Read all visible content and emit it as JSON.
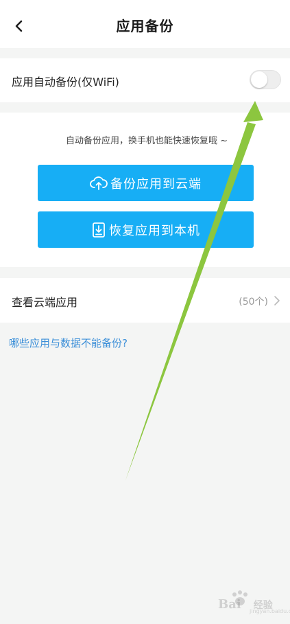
{
  "header": {
    "title": "应用备份",
    "back_icon": "chevron-left-icon"
  },
  "auto_backup": {
    "label": "应用自动备份(仅WiFi)",
    "toggle_on": false
  },
  "backup_section": {
    "hint": "自动备份应用，换手机也能快速恢复哦 ~",
    "backup_button": "备份应用到云端",
    "backup_icon": "cloud-upload-icon",
    "restore_button": "恢复应用到本机",
    "restore_icon": "download-to-device-icon"
  },
  "cloud_apps": {
    "label": "查看云端应用",
    "count": "(50个)",
    "chevron_icon": "chevron-right-icon"
  },
  "help_link": "哪些应用与数据不能备份?",
  "watermark": {
    "brand": "Bai",
    "brand_suffix": "经验",
    "sub": "jingyan.baidu.com"
  },
  "colors": {
    "primary_button": "#17aef5",
    "link": "#3a8ed8",
    "annotation_arrow": "#8cc63f"
  }
}
